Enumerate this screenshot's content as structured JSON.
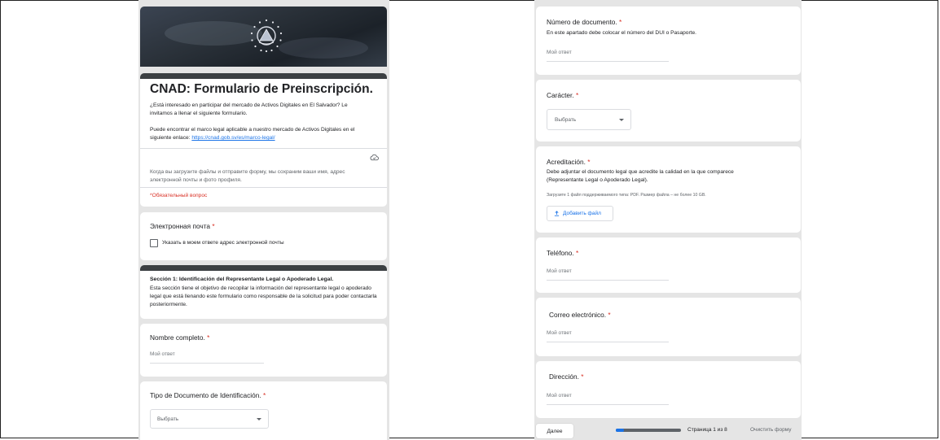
{
  "form": {
    "title": "CNAD: Formulario de Preinscripción.",
    "intro_1": "¿Está interesado en participar del mercado de Activos Digitales en El Salvador? Le invitamos a llenar el siguiente formulario.",
    "intro_2_prefix": "Puede encontrar el marco legal aplicable a nuestro mercado de Activos Digitales en el siguiente enlace: ",
    "intro_2_link": "https://cnad.gob.sv/es/marco-legal/",
    "upload_notice": "Когда вы загрузите файлы и отправите форму, мы сохраним ваши имя, адрес электронной почты и фото профиля.",
    "required_note": "*Обязательный вопрос"
  },
  "email": {
    "label": "Электронная почта",
    "required_mark": "*",
    "checkbox_label": "Указать в моем ответе адрес электронной почты"
  },
  "section1": {
    "title": "Sección 1: Identificación del Representante Legal o Apoderado Legal.",
    "description": "Esta sección tiene el objetivo de recopilar la información del representante legal o apoderado legal que está llenando este formulario como responsable de la solicitud para poder contactarla posteriormente."
  },
  "questions": {
    "full_name": {
      "label": "Nombre completo.",
      "required_mark": "*",
      "placeholder": "Мой ответ"
    },
    "doc_type": {
      "label": "Tipo de Documento de Identificación.",
      "required_mark": "*",
      "select_value": "Выбрать"
    },
    "doc_number": {
      "label": "Número de documento.",
      "required_mark": "*",
      "help": "En este apartado debe colocar el número del DUI o Pasaporte.",
      "placeholder": "Мой ответ"
    },
    "character": {
      "label": "Carácter.",
      "required_mark": "*",
      "select_value": "Выбрать"
    },
    "accreditation": {
      "label": "Acreditación.",
      "required_mark": "*",
      "help": "Debe adjuntar el documento legal que acredite la calidad en la que comparece (Representante Legal o Apoderado Legal).",
      "file_hint": "Загрузите 1 файл поддерживаемого типа: PDF. Размер файла – не более 10 GB.",
      "add_file_label": "Добавить файл"
    },
    "phone": {
      "label": "Teléfono.",
      "required_mark": "*",
      "placeholder": "Мой ответ"
    },
    "email_address": {
      "label": "Correo electrónico.",
      "required_mark": "*",
      "placeholder": "Мой ответ"
    },
    "address": {
      "label": "Dirección.",
      "required_mark": "*",
      "placeholder": "Мой ответ"
    }
  },
  "footer": {
    "next_label": "Далее",
    "page_text": "Страница 1 из 8",
    "clear_label": "Очистить форму",
    "progress_fraction": 0.125
  },
  "colors": {
    "accent": "#1a73e8",
    "required": "#d93025",
    "background": "#e5e5e5",
    "header_bg": "#2a3139"
  },
  "icons": {
    "header_emblem": "el-salvador-emblem",
    "cloud_save": "cloud-save-icon",
    "upload": "upload-icon",
    "dropdown": "chevron-down-icon"
  }
}
